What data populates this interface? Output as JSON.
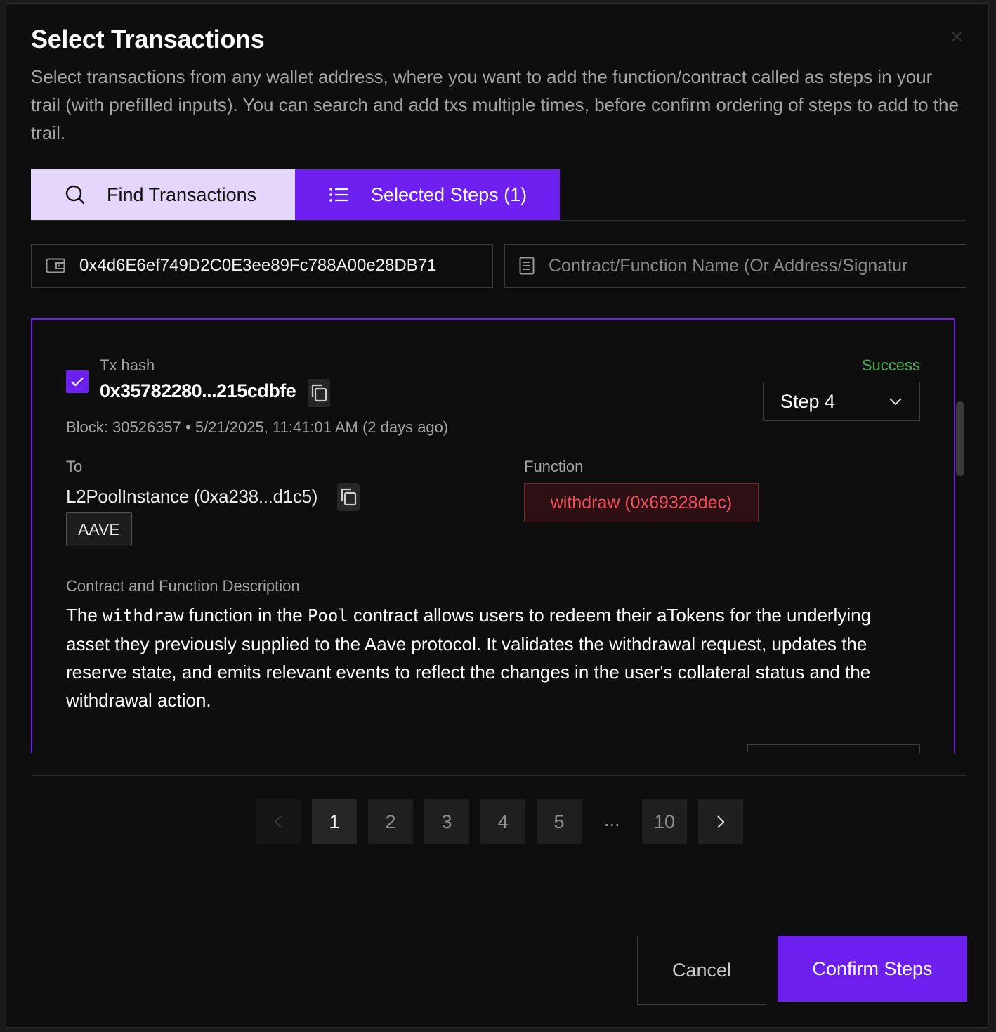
{
  "dialog": {
    "title": "Select Transactions",
    "subtitle": "Select transactions from any wallet address, where you want to add the function/contract called as steps in your trail (with prefilled inputs). You can search and add txs multiple times, before confirm ordering of steps to add to the trail."
  },
  "tabs": [
    {
      "label": "Find Transactions",
      "icon": "search-icon"
    },
    {
      "label": "Selected Steps (1)",
      "icon": "list-icon"
    }
  ],
  "search": {
    "wallet_value": "0x4d6E6ef749D2C0E3ee89Fc788A00e28DB71",
    "contract_placeholder": "Contract/Function Name (Or Address/Signatur"
  },
  "tx": {
    "hash_label": "Tx hash",
    "hash": "0x35782280...215cdbfe",
    "block_info": "Block: 30526357 • 5/21/2025, 11:41:01 AM (2 days ago)",
    "status": "Success",
    "step_value": "Step 4",
    "to_label": "To",
    "to_value": "L2PoolInstance (0xa238...d1c5)",
    "to_tag": "AAVE",
    "function_label": "Function",
    "function_value": "withdraw (0x69328dec)",
    "desc_label": "Contract and Function Description",
    "desc_1": "The ",
    "desc_code_1": "withdraw",
    "desc_2": " function in the ",
    "desc_code_2": "Pool",
    "desc_3": " contract allows users to redeem their aTokens for the underlying asset they previously supplied to the Aave protocol. It validates the withdrawal request, updates the reserve state, and emits relevant events to reflect the changes in the user's collateral status and the withdrawal action."
  },
  "pagination": {
    "pages": [
      "1",
      "2",
      "3",
      "4",
      "5"
    ],
    "ellipsis": "...",
    "last": "10",
    "current": "1"
  },
  "footer": {
    "cancel_label": "Cancel",
    "confirm_label": "Confirm Steps"
  },
  "colors": {
    "accent": "#6d1ff0",
    "tab_inactive": "#e4d5fb",
    "success": "#4caf50",
    "function_text": "#f04f5e"
  }
}
